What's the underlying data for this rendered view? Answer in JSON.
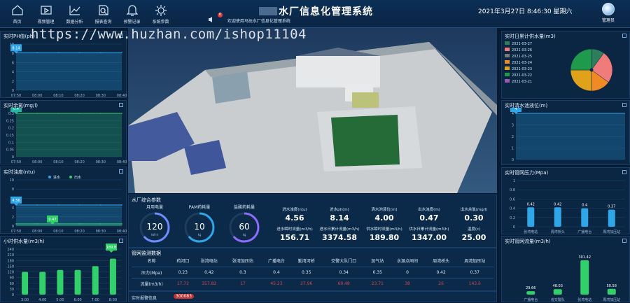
{
  "header": {
    "title": "水厂信息化管理系统",
    "datetime": "2021年3月27日  8:46:30  星期六",
    "user": "管理员",
    "notice": "欢迎使用马抚水厂信息化管理系统",
    "notice_count": "6"
  },
  "nav": [
    {
      "label": "首页",
      "icon": "home-icon"
    },
    {
      "label": "视频管理",
      "icon": "video-icon"
    },
    {
      "label": "数据分析",
      "icon": "chart-icon"
    },
    {
      "label": "报表查询",
      "icon": "report-icon"
    },
    {
      "label": "预警记录",
      "icon": "bell-icon"
    },
    {
      "label": "系统参数",
      "icon": "gear-icon"
    }
  ],
  "watermark": "https://www.huzhan.com/ishop11104",
  "colors": {
    "bg": "#071c33",
    "accent": "#2ea6e8",
    "green": "#32d06a",
    "red": "#d04848"
  },
  "panels": {
    "ph": {
      "title": "实时PH值(ph)",
      "marker": "8.14"
    },
    "chlorine": {
      "title": "实时余氯(mg/l)",
      "marker": "0.4"
    },
    "turbidity": {
      "title": "实时浊度(ntu)",
      "legend": [
        "进水",
        "出水"
      ],
      "marker_in": "4.56",
      "marker_out": "0.47"
    },
    "hourly": {
      "title": "小时供水量(m3/h)",
      "top_label": "189.8"
    },
    "daily": {
      "title": "实时日累计供水量(m3)"
    },
    "level": {
      "title": "实时清水池液位(m)",
      "marker": "4"
    },
    "pressure": {
      "title": "实时管网压力(Mpa)",
      "marker": "0.42"
    },
    "pipeflow": {
      "title": "实时管网流量(m3/h)"
    }
  },
  "params": {
    "title": "水厂综合参数",
    "gauges": [
      {
        "label": "月用电量",
        "value": "120",
        "unit": "kW·h"
      },
      {
        "label": "PAM药耗量",
        "value": "10",
        "unit": "kg"
      },
      {
        "label": "盐酸药耗量",
        "value": "60",
        "unit": "kg"
      }
    ],
    "row1": [
      {
        "label": "进水浊度(ntu)",
        "value": "4.56"
      },
      {
        "label": "进水ph(m)",
        "value": "8.14"
      },
      {
        "label": "清水池液位(m)",
        "value": "4.00"
      },
      {
        "label": "出水浊度(m)",
        "value": "0.47"
      },
      {
        "label": "出水余氯(mg/l)",
        "value": "0.30"
      }
    ],
    "row2": [
      {
        "label": "进水瞬时流量(m3/h)",
        "value": "156.71"
      },
      {
        "label": "进水日累计流量(m3/h)",
        "value": "3374.58"
      },
      {
        "label": "供水瞬时流量(m3/h)",
        "value": "189.80"
      },
      {
        "label": "供水日累计流量(m3/h)",
        "value": "1347.00"
      },
      {
        "label": "温度(c)",
        "value": "25.00"
      }
    ]
  },
  "pipe": {
    "title": "管网监测数据",
    "headers": [
      "名称",
      "药河口",
      "张湾电站",
      "张湾加压站",
      "广播电台",
      "勤湾河桥",
      "交警大队门口",
      "加气站",
      "水源点闸间",
      "周湾桥头",
      "周湾加压站"
    ],
    "pressure": [
      "压力(Mpa)",
      "0.23",
      "0.42",
      "0.3",
      "0.4",
      "0.35",
      "0.34",
      "0.35",
      "0",
      "0.42",
      "0.37"
    ],
    "flow": [
      "流量(m3/h)",
      "17.72",
      "357.82",
      "17",
      "45.23",
      "27.96",
      "69.48",
      "23.71",
      "38",
      "26",
      "143.6"
    ]
  },
  "alarm": {
    "title": "实时报警信息",
    "count": "300083"
  },
  "chart_data": [
    {
      "type": "line",
      "title": "实时PH值(ph)",
      "x": [
        "07:50",
        "08:00",
        "08:10",
        "08:20",
        "08:30",
        "08:40"
      ],
      "ylim": [
        0,
        10
      ],
      "yticks": [
        0,
        2,
        4,
        6,
        8,
        10
      ],
      "series": [
        {
          "values": [
            8.14,
            8.14,
            8.14,
            8.14,
            8.14,
            8.14
          ]
        }
      ]
    },
    {
      "type": "line",
      "title": "实时余氯(mg/l)",
      "x": [
        "07:50",
        "08:00",
        "08:10",
        "08:20",
        "08:30",
        "08:40"
      ],
      "ylim": [
        0,
        0.3
      ],
      "yticks": [
        0,
        0.05,
        0.1,
        0.15,
        0.2,
        0.25,
        0.3
      ],
      "series": [
        {
          "values": [
            0.3,
            0.3,
            0.3,
            0.3,
            0.3,
            0.3
          ]
        }
      ]
    },
    {
      "type": "line",
      "title": "实时浊度(ntu)",
      "x": [
        "07:50",
        "08:00",
        "08:10",
        "08:20",
        "08:30",
        "08:40"
      ],
      "ylim": [
        0,
        10
      ],
      "yticks": [
        0,
        2,
        4,
        6,
        8,
        10
      ],
      "series": [
        {
          "name": "进水",
          "values": [
            4.56,
            4.56,
            4.56,
            4.56,
            4.56,
            4.56
          ]
        },
        {
          "name": "出水",
          "values": [
            0.47,
            0.47,
            0.47,
            0.47,
            0.47,
            0.47
          ]
        }
      ]
    },
    {
      "type": "bar",
      "title": "小时供水量(m3/h)",
      "categories": [
        "3:00",
        "4:00",
        "5:00",
        "6:00",
        "7:00",
        "8:00"
      ],
      "ylim": [
        0,
        240
      ],
      "yticks": [
        0,
        30,
        60,
        90,
        120,
        150,
        180,
        210,
        240
      ],
      "values": [
        120,
        120,
        130,
        130,
        150,
        189.8
      ]
    },
    {
      "type": "pie",
      "title": "实时日累计供水量(m3)",
      "labels": [
        "2021-03-27",
        "2021-03-26",
        "2021-03-25",
        "2021-03-24",
        "2021-03-23",
        "2021-03-22",
        "2021-03-21"
      ],
      "values": [
        10,
        25,
        0,
        15,
        25,
        25,
        0
      ],
      "colors": [
        "#2e7d5b",
        "#ef7b7b",
        "#7a7a7a",
        "#f08a24",
        "#e0a21b",
        "#1f9a4d",
        "#9b59b6"
      ]
    },
    {
      "type": "line",
      "title": "实时清水池液位(m)",
      "ylim": [
        0,
        4
      ],
      "yticks": [
        0,
        1,
        2,
        3,
        4
      ],
      "series": [
        {
          "values": [
            4,
            4,
            4,
            4,
            4,
            4
          ]
        }
      ]
    },
    {
      "type": "bar",
      "title": "实时管网压力(Mpa)",
      "categories": [
        "张湾电站",
        "周湾桥头",
        "广播电台",
        "周湾加压站"
      ],
      "ylim": [
        0,
        1
      ],
      "yticks": [
        0,
        0.2,
        0.4,
        0.6,
        0.8,
        1
      ],
      "values": [
        0.42,
        0.42,
        0.4,
        0.37
      ]
    },
    {
      "type": "bar",
      "title": "实时管网流量(m3/h)",
      "categories": [
        "广播电台",
        "省交警队",
        "张湾电站",
        "周湾加压站"
      ],
      "ylim": [
        0,
        400
      ],
      "yticks": [
        0,
        100,
        200,
        300,
        400
      ],
      "values": [
        29.66,
        48.03,
        301.42,
        50.58
      ]
    }
  ]
}
